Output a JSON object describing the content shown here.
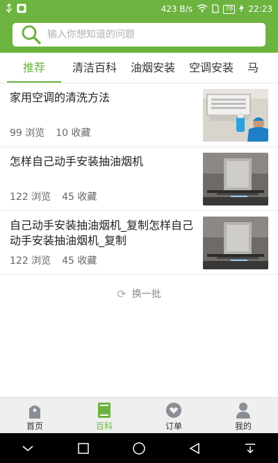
{
  "status_bar": {
    "speed": "423 B/s",
    "battery": "78",
    "time": "22:23",
    "icons": [
      "usb-icon",
      "app-notification-icon",
      "wifi-icon",
      "sim-icon",
      "battery-icon",
      "charging-icon"
    ]
  },
  "search": {
    "placeholder": "输入你想知道的问题"
  },
  "tabs": [
    {
      "label": "推荐",
      "active": true
    },
    {
      "label": "清洁百科",
      "active": false
    },
    {
      "label": "油烟安装",
      "active": false
    },
    {
      "label": "空调安装",
      "active": false
    },
    {
      "label": "马",
      "active": false
    }
  ],
  "articles": [
    {
      "title": "家用空调的清洗方法",
      "views": "99 浏览",
      "favorites": "10 收藏",
      "thumb": "air-conditioner-cleaning-photo"
    },
    {
      "title": "怎样自己动手安装抽油烟机",
      "views": "122 浏览",
      "favorites": "45 收藏",
      "thumb": "range-hood-photo"
    },
    {
      "title": "自己动手安装抽油烟机_复制怎样自己动手安装抽油烟机_复制",
      "views": "122 浏览",
      "favorites": "45 收藏",
      "thumb": "range-hood-photo"
    }
  ],
  "refresh": {
    "label": "换一批"
  },
  "bottom_nav": [
    {
      "label": "首页",
      "icon": "home-icon",
      "active": false
    },
    {
      "label": "百科",
      "icon": "book-icon",
      "active": true
    },
    {
      "label": "订单",
      "icon": "heart-icon",
      "active": false
    },
    {
      "label": "我的",
      "icon": "user-icon",
      "active": false
    }
  ],
  "colors": {
    "brand": "#6cb33f",
    "text": "#222222",
    "muted": "#666666"
  }
}
